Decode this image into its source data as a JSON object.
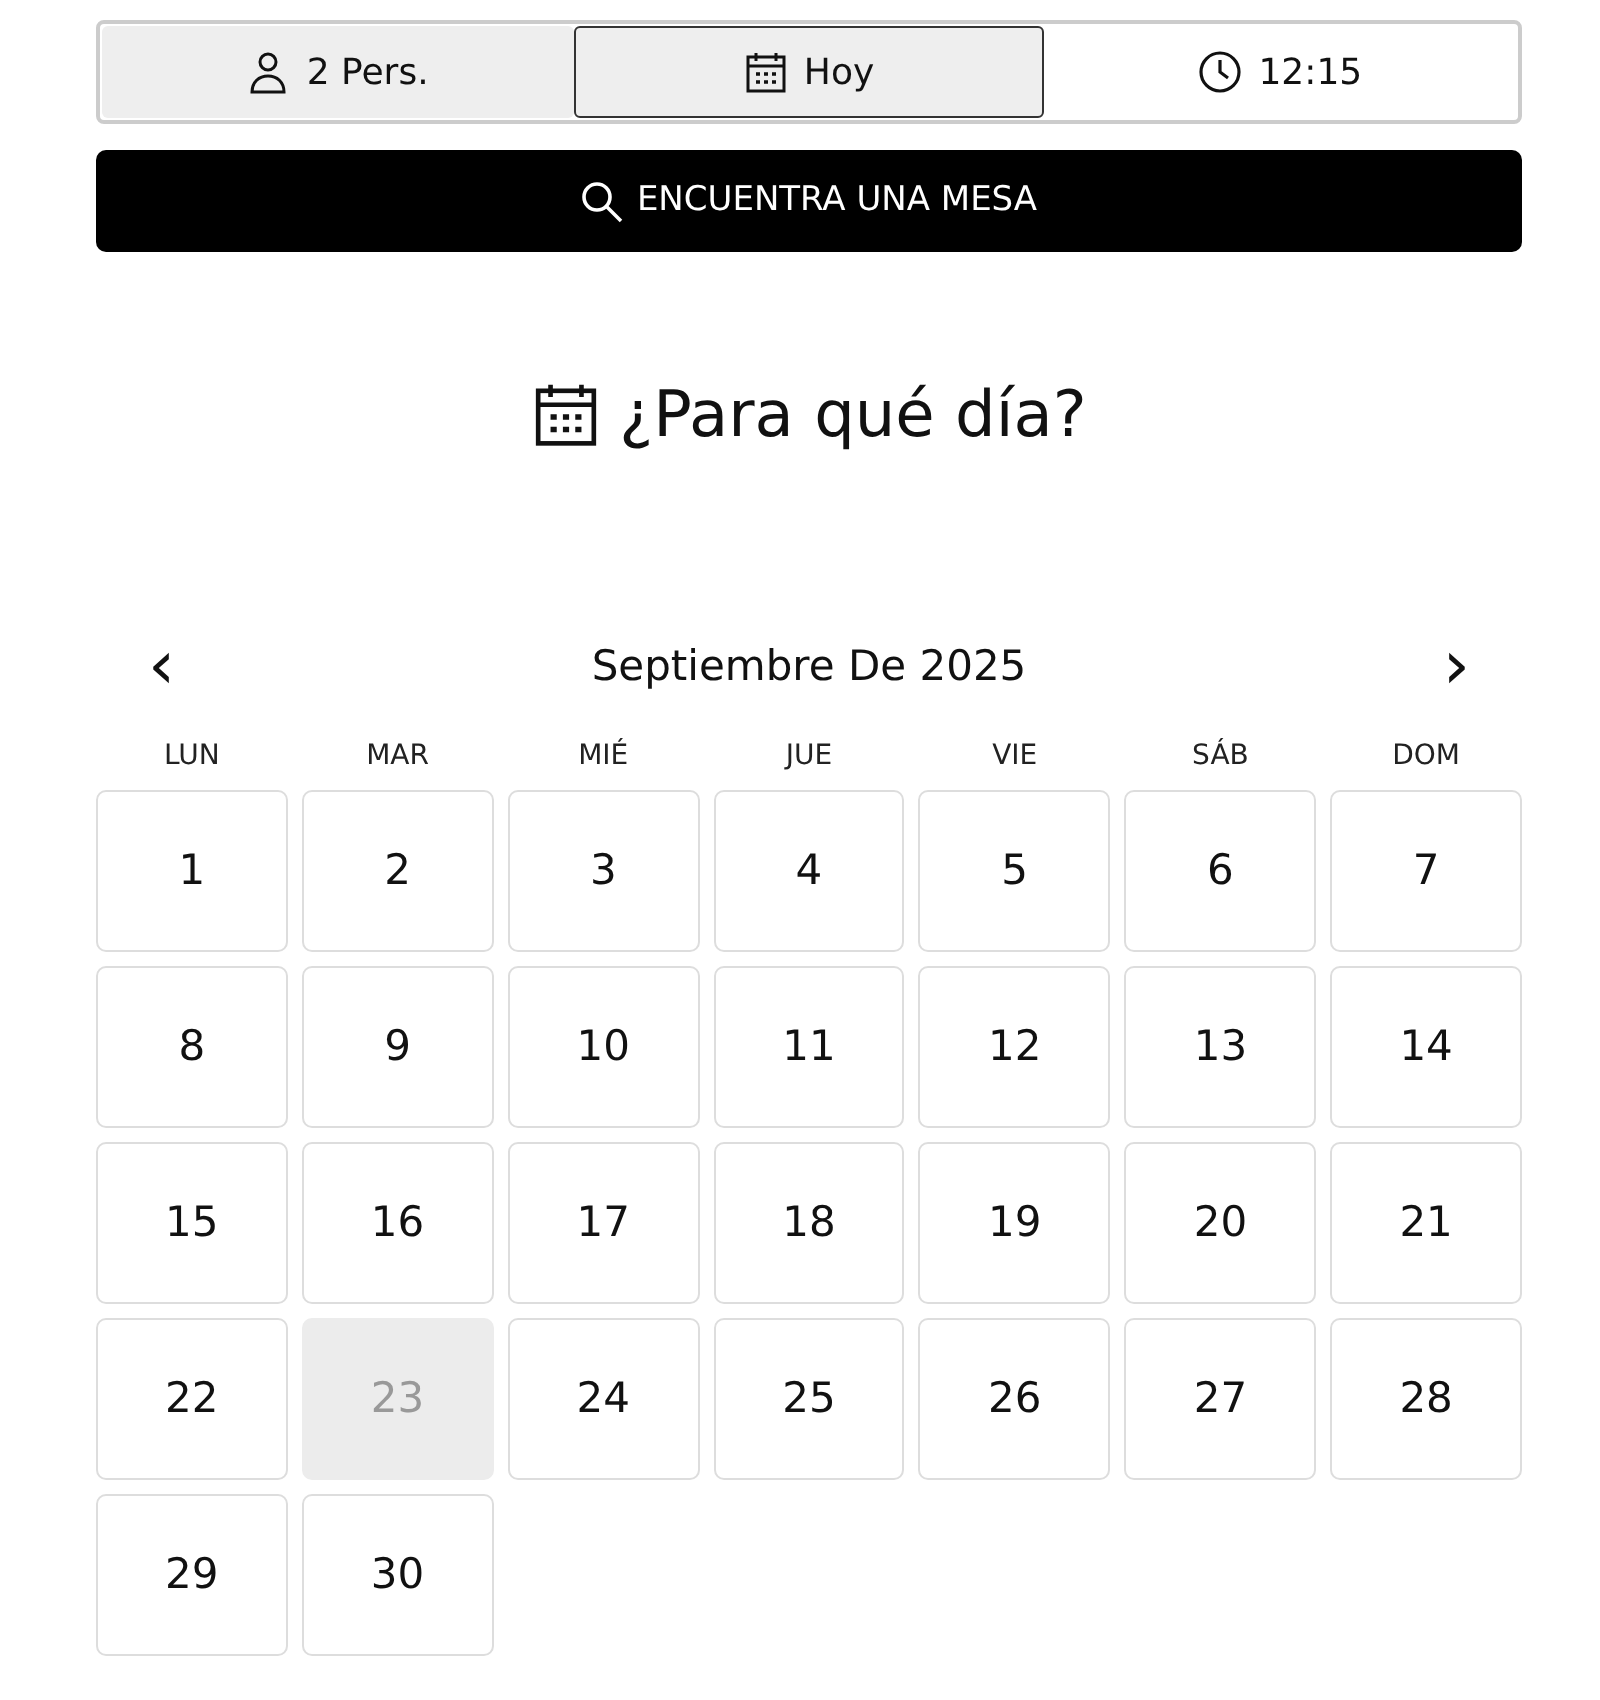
{
  "tabs": [
    {
      "kind": "people",
      "label": "2 Pers.",
      "selected": false,
      "completed": true
    },
    {
      "kind": "date",
      "label": "Hoy",
      "selected": true,
      "completed": true
    },
    {
      "kind": "time",
      "label": "12:15",
      "selected": false,
      "completed": false
    }
  ],
  "search_button": "ENCUENTRA UNA MESA",
  "heading": "¿Para qué día?",
  "calendar": {
    "month": "Septiembre De 2025",
    "prev": "‹",
    "next": "›",
    "weekdays": [
      "LUN",
      "MAR",
      "MIÉ",
      "JUE",
      "VIE",
      "SÁB",
      "DOM"
    ],
    "days": [
      {
        "label": "1",
        "disabled": false
      },
      {
        "label": "2",
        "disabled": false
      },
      {
        "label": "3",
        "disabled": false
      },
      {
        "label": "4",
        "disabled": false
      },
      {
        "label": "5",
        "disabled": false
      },
      {
        "label": "6",
        "disabled": false
      },
      {
        "label": "7",
        "disabled": false
      },
      {
        "label": "8",
        "disabled": false
      },
      {
        "label": "9",
        "disabled": false
      },
      {
        "label": "10",
        "disabled": false
      },
      {
        "label": "11",
        "disabled": false
      },
      {
        "label": "12",
        "disabled": false
      },
      {
        "label": "13",
        "disabled": false
      },
      {
        "label": "14",
        "disabled": false
      },
      {
        "label": "15",
        "disabled": false
      },
      {
        "label": "16",
        "disabled": false
      },
      {
        "label": "17",
        "disabled": false
      },
      {
        "label": "18",
        "disabled": false
      },
      {
        "label": "19",
        "disabled": false
      },
      {
        "label": "20",
        "disabled": false
      },
      {
        "label": "21",
        "disabled": false
      },
      {
        "label": "22",
        "disabled": false
      },
      {
        "label": "23",
        "disabled": true
      },
      {
        "label": "24",
        "disabled": false
      },
      {
        "label": "25",
        "disabled": false
      },
      {
        "label": "26",
        "disabled": false
      },
      {
        "label": "27",
        "disabled": false
      },
      {
        "label": "28",
        "disabled": false
      },
      {
        "label": "29",
        "disabled": false
      },
      {
        "label": "30",
        "disabled": false
      }
    ]
  }
}
